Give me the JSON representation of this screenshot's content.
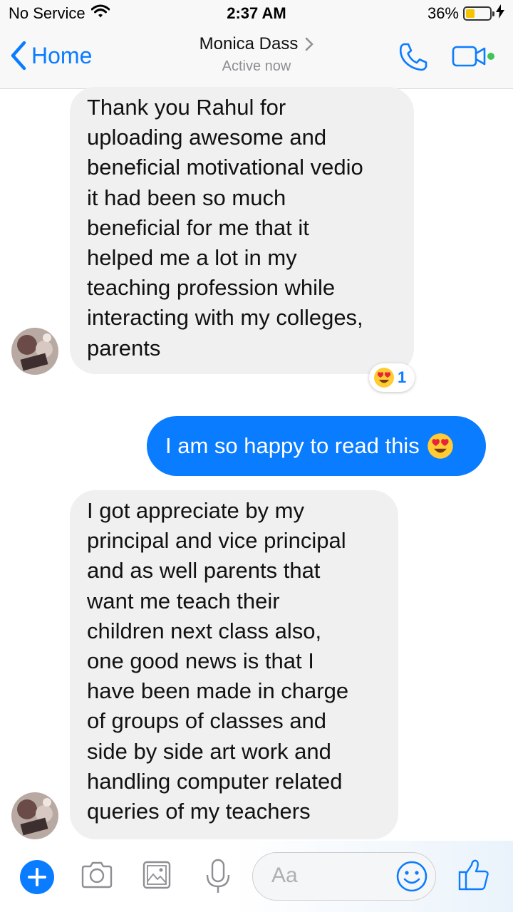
{
  "status_bar": {
    "carrier": "No Service",
    "time": "2:37 AM",
    "battery": "36%",
    "battery_level": 0.36,
    "icons": [
      "wifi-icon",
      "battery-icon",
      "charging-bolt-icon"
    ]
  },
  "header": {
    "back_label": "Home",
    "contact_name": "Monica Dass",
    "status": "Active now",
    "icons": [
      "back-chevron-icon",
      "chevron-right-icon",
      "phone-icon",
      "video-camera-icon"
    ],
    "accent": "#0a7cff",
    "online_dot": "#44c25a"
  },
  "messages": [
    {
      "direction": "incoming",
      "lines": [
        "Thank you Rahul  for",
        "uploading awesome and",
        "beneficial  motivational  vedio",
        "it had  been  so much",
        "beneficial  for  me  that  it",
        "helped  me a lot  in  my",
        "teaching  profession  while",
        "interacting  with my  colleges,",
        "parents"
      ],
      "reaction": {
        "emoji": "heart-eyes-emoji",
        "count": "1"
      }
    },
    {
      "direction": "outgoing",
      "text": "I am so happy to read this",
      "emoji": "heart-eyes-emoji"
    },
    {
      "direction": "incoming",
      "lines": [
        "I got  appreciate by  my",
        "principal  and  vice  principal",
        "and  as  well  parents  that",
        "want  me  teach  their",
        "children  next  class  also,",
        "one  good  news  is  that  I",
        "have  been  made  in charge",
        "of  groups of  classes and",
        "side  by  side art  work  and",
        "handling  computer  related",
        "queries of  my  teachers"
      ]
    }
  ],
  "composer": {
    "placeholder": "Aa",
    "icons": [
      "plus-icon",
      "camera-icon",
      "image-icon",
      "microphone-icon",
      "emoji-icon",
      "thumbs-up-icon"
    ]
  },
  "colors": {
    "outgoing_bubble": "#0a7cff",
    "incoming_bubble": "#f1f0f0"
  }
}
